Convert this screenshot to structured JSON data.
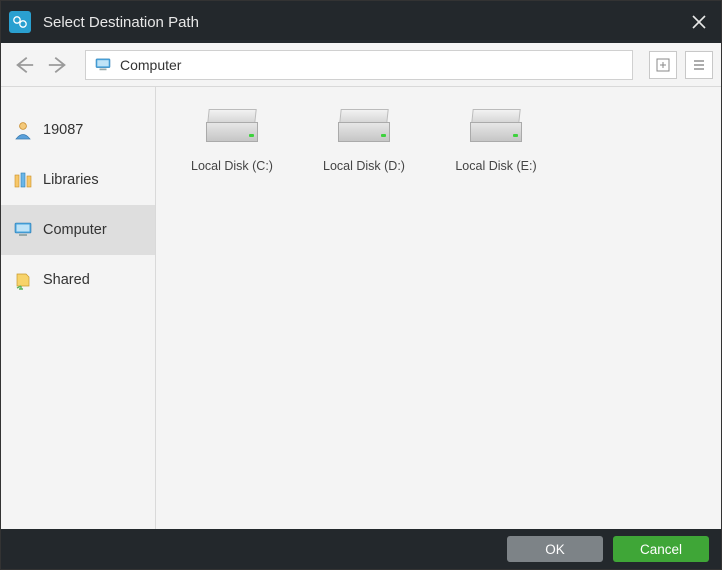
{
  "title": "Select Destination Path",
  "path": {
    "label": "Computer"
  },
  "sidebar": {
    "items": [
      {
        "label": "19087",
        "icon": "user-icon",
        "selected": false
      },
      {
        "label": "Libraries",
        "icon": "libraries-icon",
        "selected": false
      },
      {
        "label": "Computer",
        "icon": "computer-icon",
        "selected": true
      },
      {
        "label": "Shared",
        "icon": "shared-icon",
        "selected": false
      }
    ]
  },
  "disks": [
    {
      "label": "Local Disk (C:)"
    },
    {
      "label": "Local Disk (D:)"
    },
    {
      "label": "Local Disk (E:)"
    }
  ],
  "buttons": {
    "ok": "OK",
    "cancel": "Cancel"
  }
}
